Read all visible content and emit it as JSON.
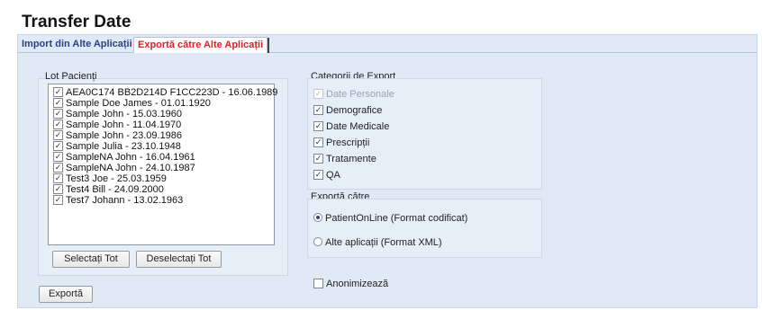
{
  "page": {
    "title": "Transfer Date"
  },
  "tabs": [
    {
      "label": "Import din Alte Aplicații"
    },
    {
      "label": "Exportă către Alte Aplicații"
    }
  ],
  "patients": {
    "label": "Lot Pacienți",
    "items": [
      {
        "label": "AEA0C174 BB2D214D F1CC223D - 16.06.1989",
        "checked": true
      },
      {
        "label": "Sample Doe James - 01.01.1920",
        "checked": true
      },
      {
        "label": "Sample John - 15.03.1960",
        "checked": true
      },
      {
        "label": "Sample John - 11.04.1970",
        "checked": true
      },
      {
        "label": "Sample John - 23.09.1986",
        "checked": true
      },
      {
        "label": "Sample Julia - 23.10.1948",
        "checked": true
      },
      {
        "label": "SampleNA John - 16.04.1961",
        "checked": true
      },
      {
        "label": "SampleNA John - 24.10.1987",
        "checked": true
      },
      {
        "label": "Test3 Joe - 25.03.1959",
        "checked": true
      },
      {
        "label": "Test4 Bill - 24.09.2000",
        "checked": true
      },
      {
        "label": "Test7 Johann - 13.02.1963",
        "checked": true
      }
    ],
    "select_all_label": "Selectați Tot",
    "deselect_all_label": "Deselectați Tot"
  },
  "categories": {
    "label": "Categorii de Export",
    "items": [
      {
        "label": "Date Personale",
        "checked": true,
        "disabled": true
      },
      {
        "label": "Demografice",
        "checked": true,
        "disabled": false
      },
      {
        "label": "Date Medicale",
        "checked": true,
        "disabled": false
      },
      {
        "label": "Prescripții",
        "checked": true,
        "disabled": false
      },
      {
        "label": "Tratamente",
        "checked": true,
        "disabled": false
      },
      {
        "label": "QA",
        "checked": true,
        "disabled": false
      }
    ]
  },
  "export_to": {
    "label": "Exportă către",
    "options": [
      {
        "label": "PatientOnLine (Format codificat)",
        "selected": true
      },
      {
        "label": "Alte aplicații (Format XML)",
        "selected": false
      }
    ]
  },
  "anonymize": {
    "label": "Anonimizează",
    "checked": false
  },
  "export_button_label": "Exportă",
  "colors": {
    "accent_tab": "#d6232b",
    "tab_text": "#2a3f86",
    "panel_bg": "#dfeaf6"
  }
}
